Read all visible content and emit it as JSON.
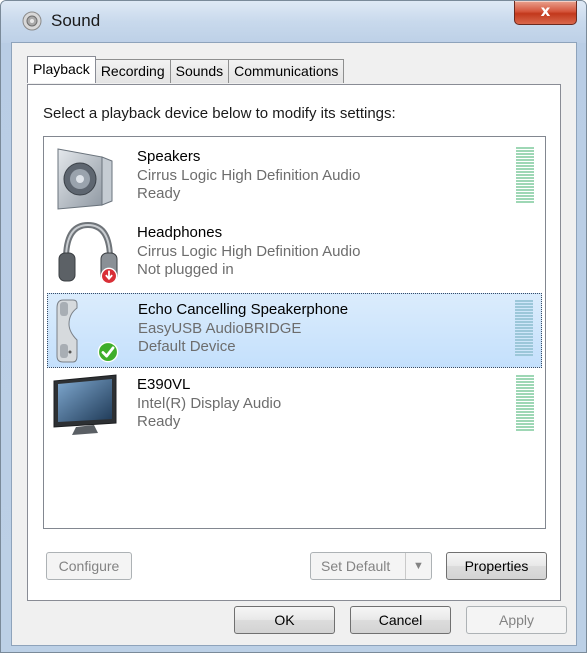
{
  "window": {
    "title": "Sound",
    "close_glyph": "x"
  },
  "tabs": [
    {
      "label": "Playback",
      "active": true
    },
    {
      "label": "Recording",
      "active": false
    },
    {
      "label": "Sounds",
      "active": false
    },
    {
      "label": "Communications",
      "active": false
    }
  ],
  "playback": {
    "instruction": "Select a playback device below to modify its settings:",
    "devices": [
      {
        "name": "Speakers",
        "driver": "Cirrus Logic High Definition Audio",
        "status": "Ready",
        "icon": "speaker-icon",
        "selected": false,
        "has_level_meter": true
      },
      {
        "name": "Headphones",
        "driver": "Cirrus Logic High Definition Audio",
        "status": "Not plugged in",
        "icon": "headphones-icon",
        "badge": "unplugged-badge-icon",
        "selected": false,
        "has_level_meter": false
      },
      {
        "name": "Echo Cancelling Speakerphone",
        "driver": "EasyUSB AudioBRIDGE",
        "status": "Default Device",
        "icon": "speakerphone-icon",
        "badge": "default-check-badge-icon",
        "selected": true,
        "has_level_meter": true
      },
      {
        "name": "E390VL",
        "driver": "Intel(R) Display Audio",
        "status": "Ready",
        "icon": "monitor-icon",
        "selected": false,
        "has_level_meter": true
      }
    ],
    "configure_label": "Configure",
    "set_default_label": "Set Default",
    "properties_label": "Properties"
  },
  "footer": {
    "ok_label": "OK",
    "cancel_label": "Cancel",
    "apply_label": "Apply"
  },
  "colors": {
    "selection": "#c4e0fc",
    "level_meter": "#9ed7b5",
    "default_check": "#3fae2a",
    "unplugged_badge": "#c8232c"
  }
}
